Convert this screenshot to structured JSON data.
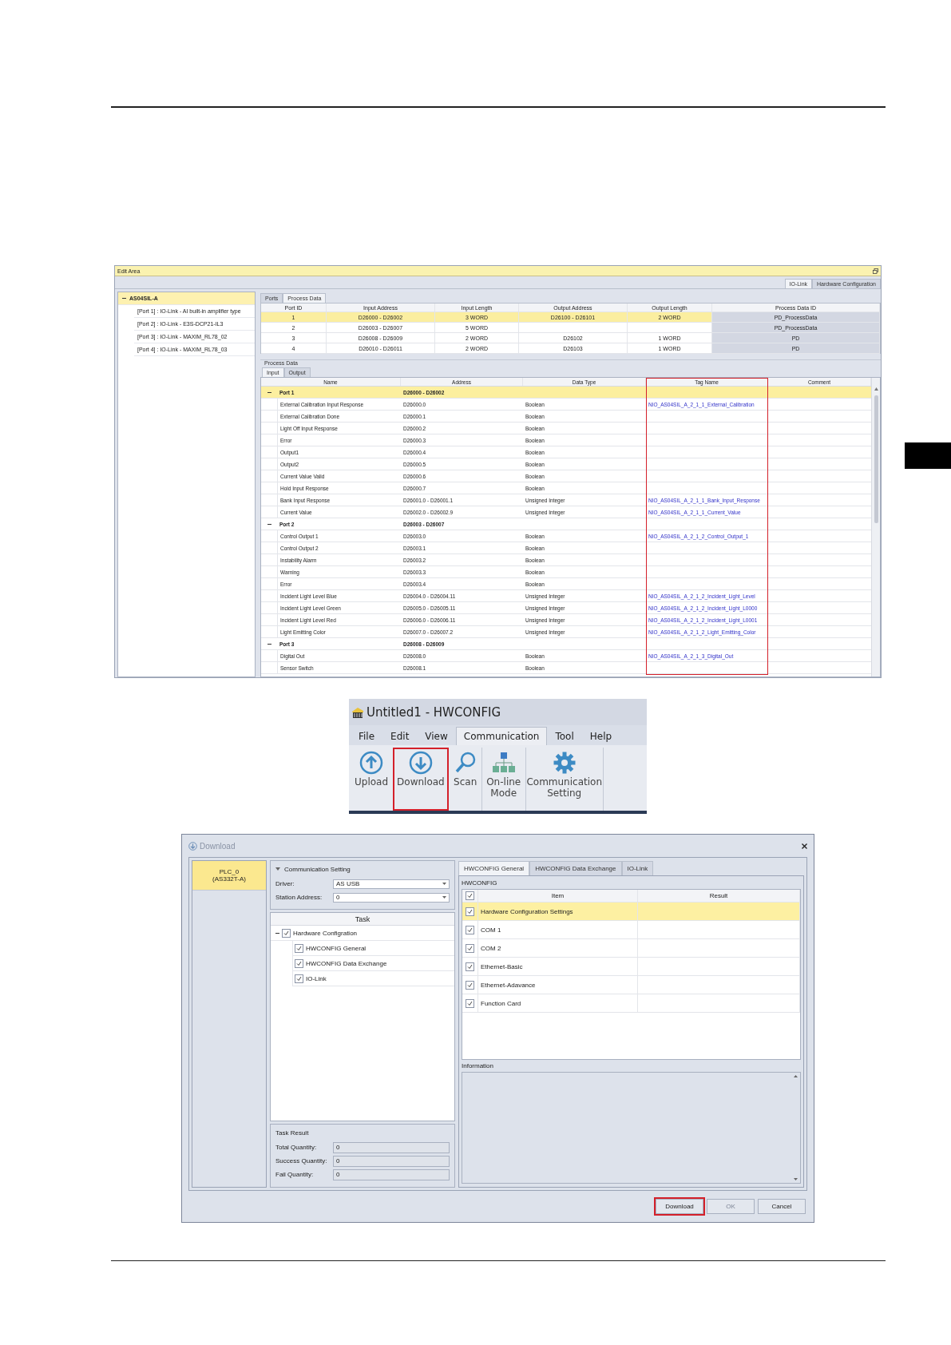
{
  "edit_area": {
    "title": "Edit Area",
    "view_tabs": [
      {
        "label": "IO-Link",
        "selected": true
      },
      {
        "label": "Hardware Configuration",
        "selected": false
      }
    ],
    "tree": {
      "label": "AS04SIL-A",
      "expanded": true,
      "selected": true,
      "children": [
        {
          "label": "[Port 1] : IO-Link - AI built-in amplifier type",
          "selected": false
        },
        {
          "label": "[Port 2] : IO-Link - E3S-DCP21-IL3",
          "selected": false
        },
        {
          "label": "[Port 3] : IO-Link - MAXIM_RL78_02",
          "selected": false
        },
        {
          "label": "[Port 4] : IO-Link - MAXIM_RL78_03",
          "selected": false
        }
      ]
    },
    "port_tabs": [
      {
        "label": "Ports",
        "selected": false
      },
      {
        "label": "Process Data",
        "selected": true
      }
    ],
    "ports_table": {
      "columns": [
        "Port ID",
        "Input Address",
        "Input Length",
        "Output Address",
        "Output Length",
        "Process Data ID"
      ],
      "rows": [
        {
          "port_id": "1",
          "input_address": "D26000 - D26002",
          "input_length": "3 WORD",
          "output_address": "D26100 - D26101",
          "output_length": "2 WORD",
          "process_data_id": "PD_ProcessData",
          "selected": true
        },
        {
          "port_id": "2",
          "input_address": "D26003 - D26007",
          "input_length": "5 WORD",
          "process_data_id": "PD_ProcessData",
          "selected": false
        },
        {
          "port_id": "3",
          "input_address": "D26008 - D26009",
          "input_length": "2 WORD",
          "output_address": "D26102",
          "output_length": "1 WORD",
          "process_data_id": "PD",
          "selected": false
        },
        {
          "port_id": "4",
          "input_address": "D26010 - D26011",
          "input_length": "2 WORD",
          "output_address": "D26103",
          "output_length": "1 WORD",
          "process_data_id": "PD",
          "selected": false
        }
      ]
    },
    "process_data": {
      "title": "Process Data",
      "tabs": [
        {
          "label": "Input",
          "selected": true
        },
        {
          "label": "Output",
          "selected": false
        }
      ],
      "columns": [
        {
          "label": "Name",
          "highlighted": false
        },
        {
          "label": "Address",
          "highlighted": false
        },
        {
          "label": "Data Type",
          "highlighted": false
        },
        {
          "label": "Tag Name",
          "highlighted": true
        },
        {
          "label": "Comment",
          "highlighted": false
        }
      ],
      "groups": [
        {
          "name": "Port 1",
          "address": "D26000 - D26002",
          "expanded": true,
          "selected": true,
          "items": [
            {
              "name": "External Calibration Input Response",
              "address": "D26000.0",
              "data_type": "Boolean",
              "tag_name": "NIO_AS04SIL_A_2_1_1_External_Calibration"
            },
            {
              "name": "External Calibration Done",
              "address": "D26000.1",
              "data_type": "Boolean"
            },
            {
              "name": "Light Off Input Response",
              "address": "D26000.2",
              "data_type": "Boolean"
            },
            {
              "name": "Error",
              "address": "D26000.3",
              "data_type": "Boolean"
            },
            {
              "name": "Output1",
              "address": "D26000.4",
              "data_type": "Boolean"
            },
            {
              "name": "Output2",
              "address": "D26000.5",
              "data_type": "Boolean"
            },
            {
              "name": "Current Value Valid",
              "address": "D26000.6",
              "data_type": "Boolean"
            },
            {
              "name": "Hold Input Response",
              "address": "D26000.7",
              "data_type": "Boolean"
            },
            {
              "name": "Bank Input Response",
              "address": "D26001.0 - D26001.1",
              "data_type": "Unsigned Integer",
              "tag_name": "NIO_AS04SIL_A_2_1_1_Bank_Input_Response"
            },
            {
              "name": "Current Value",
              "address": "D26002.0 - D26002.9",
              "data_type": "Unsigned Integer",
              "tag_name": "NIO_AS04SIL_A_2_1_1_Current_Value"
            }
          ]
        },
        {
          "name": "Port 2",
          "address": "D26003 - D26007",
          "expanded": true,
          "selected": false,
          "items": [
            {
              "name": "Control Output 1",
              "address": "D26003.0",
              "data_type": "Boolean",
              "tag_name": "NIO_AS04SIL_A_2_1_2_Control_Output_1"
            },
            {
              "name": "Control Output 2",
              "address": "D26003.1",
              "data_type": "Boolean"
            },
            {
              "name": "Instability Alarm",
              "address": "D26003.2",
              "data_type": "Boolean"
            },
            {
              "name": "Warning",
              "address": "D26003.3",
              "data_type": "Boolean"
            },
            {
              "name": "Error",
              "address": "D26003.4",
              "data_type": "Boolean"
            },
            {
              "name": "Incident Light Level Blue",
              "address": "D26004.0 - D26004.11",
              "data_type": "Unsigned Integer",
              "tag_name": "NIO_AS04SIL_A_2_1_2_Incident_Light_Level"
            },
            {
              "name": "Incident Light Level Green",
              "address": "D26005.0 - D26005.11",
              "data_type": "Unsigned Integer",
              "tag_name": "NIO_AS04SIL_A_2_1_2_Incident_Light_L0000"
            },
            {
              "name": "Incident Light Level Red",
              "address": "D26006.0 - D26006.11",
              "data_type": "Unsigned Integer",
              "tag_name": "NIO_AS04SIL_A_2_1_2_Incident_Light_L0001"
            },
            {
              "name": "Light Emitting Color",
              "address": "D26007.0 - D26007.2",
              "data_type": "Unsigned Integer",
              "tag_name": "NIO_AS04SIL_A_2_1_2_Light_Emitting_Color"
            }
          ]
        },
        {
          "name": "Port 3",
          "address": "D26008 - D26009",
          "expanded": true,
          "selected": false,
          "items": [
            {
              "name": "Digital Out",
              "address": "D26008.0",
              "data_type": "Boolean",
              "tag_name": "NIO_AS04SIL_A_2_1_3_Digital_Out"
            },
            {
              "name": "Sensor Switch",
              "address": "D26008.1",
              "data_type": "Boolean"
            }
          ]
        }
      ]
    }
  },
  "hwconfig": {
    "title": "Untitled1 - HWCONFIG",
    "menu": [
      {
        "label": "File",
        "selected": false
      },
      {
        "label": "Edit",
        "selected": false
      },
      {
        "label": "View",
        "selected": false
      },
      {
        "label": "Communication",
        "selected": true
      },
      {
        "label": "Tool",
        "selected": false
      },
      {
        "label": "Help",
        "selected": false
      }
    ],
    "ribbon": [
      {
        "label": "Upload",
        "kind": "upload",
        "highlighted": false
      },
      {
        "label": "Download",
        "kind": "download",
        "highlighted": true
      },
      {
        "label": "Scan",
        "kind": "scan",
        "highlighted": false
      },
      {
        "label": "On-line Mode",
        "kind": "online",
        "highlighted": false
      },
      {
        "label": "Communication Setting",
        "kind": "settings",
        "highlighted": false
      }
    ]
  },
  "download_dialog": {
    "title": "Download",
    "devices": [
      {
        "name": "PLC_0",
        "model": "(AS332T-A)",
        "selected": true
      }
    ],
    "communication": {
      "title": "Communication Setting",
      "expanded": true,
      "fields": [
        {
          "label": "Driver:",
          "value": "AS USB"
        },
        {
          "label": "Station Address:",
          "value": "0"
        }
      ]
    },
    "task": {
      "header": "Task",
      "tree": {
        "label": "Hardware Configration",
        "expanded": true,
        "checked": true,
        "children": [
          {
            "label": "HWCONFIG General",
            "checked": true
          },
          {
            "label": "HWCONFIG Data Exchange",
            "checked": true
          },
          {
            "label": "IO-Link",
            "checked": true
          }
        ]
      }
    },
    "task_result": {
      "title": "Task Result",
      "fields": [
        {
          "label": "Total Quantity:",
          "value": "0"
        },
        {
          "label": "Success Quantity:",
          "value": "0"
        },
        {
          "label": "Fail Quantity:",
          "value": "0"
        }
      ]
    },
    "tabs": [
      {
        "label": "HWCONFIG General",
        "selected": true
      },
      {
        "label": "HWCONFIG Data Exchange",
        "selected": false
      },
      {
        "label": "IO-Link",
        "selected": false
      }
    ],
    "hwconfig_group": {
      "title": "HWCONFIG",
      "all_checked": true,
      "columns": [
        "Item",
        "Result"
      ],
      "rows": [
        {
          "item": "Hardware Configuration Settings",
          "checked": true,
          "selected": true
        },
        {
          "item": "COM 1",
          "checked": true,
          "selected": false
        },
        {
          "item": "COM 2",
          "checked": true,
          "selected": false
        },
        {
          "item": "Ethernet-Basic",
          "checked": true,
          "selected": false
        },
        {
          "item": "Ethernet-Adavance",
          "checked": true,
          "selected": false
        },
        {
          "item": "Function Card",
          "checked": true,
          "selected": false
        }
      ]
    },
    "information": {
      "title": "Information"
    },
    "buttons": [
      {
        "label": "Download",
        "highlighted": true,
        "disabled": false
      },
      {
        "label": "OK",
        "highlighted": false,
        "disabled": true
      },
      {
        "label": "Cancel",
        "highlighted": false,
        "disabled": false
      }
    ]
  }
}
